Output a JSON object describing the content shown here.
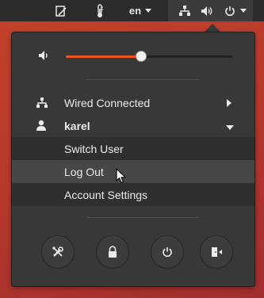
{
  "topbar": {
    "icons": [
      "notes-icon",
      "thermometer-icon",
      "network-icon",
      "volume-icon",
      "power-icon"
    ],
    "language_label": "en"
  },
  "menu": {
    "volume": {
      "icon": "volume-low-icon",
      "level": 0.45
    },
    "network": {
      "label": "Wired Connected",
      "icon": "network-icon"
    },
    "user": {
      "name": "karel",
      "icon": "user-icon",
      "items": [
        {
          "label": "Switch User"
        },
        {
          "label": "Log Out"
        },
        {
          "label": "Account Settings"
        }
      ]
    },
    "actions": [
      "settings-icon",
      "lock-icon",
      "power-icon",
      "logout-icon"
    ]
  },
  "colors": {
    "accent": "#e95420",
    "menu_bg": "#383838",
    "topbar_bg": "#2c2c2c",
    "desktop": "#b83a2c"
  }
}
